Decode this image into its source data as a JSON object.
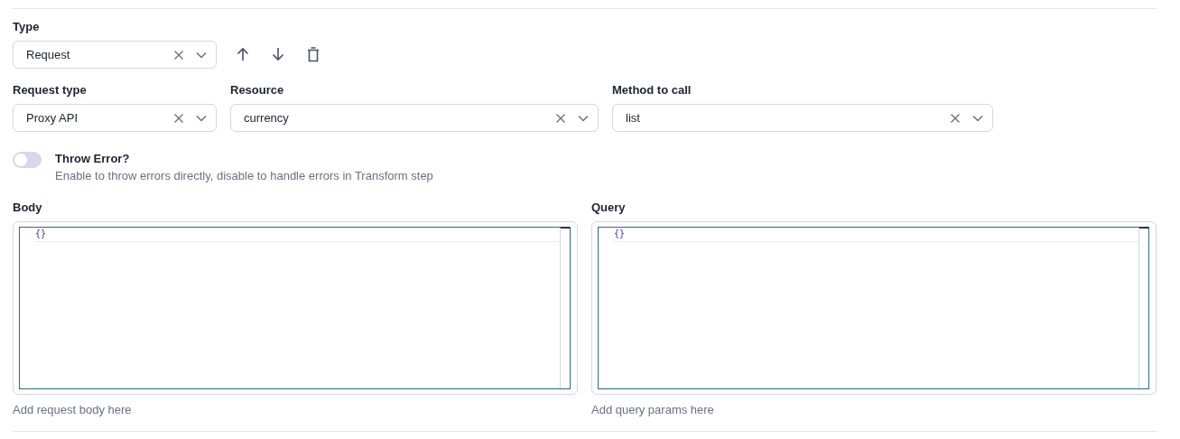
{
  "type_field": {
    "label": "Type",
    "value": "Request"
  },
  "selects": [
    {
      "label": "Request type",
      "value": "Proxy API"
    },
    {
      "label": "Resource",
      "value": "currency"
    },
    {
      "label": "Method to call",
      "value": "list"
    }
  ],
  "throw_error": {
    "label": "Throw Error?",
    "description": "Enable to throw errors directly, disable to handle errors in Transform step",
    "on": false
  },
  "editors": [
    {
      "label": "Body",
      "code": "{}",
      "help": "Add request body here"
    },
    {
      "label": "Query",
      "code": "{}",
      "help": "Add query params here"
    }
  ]
}
